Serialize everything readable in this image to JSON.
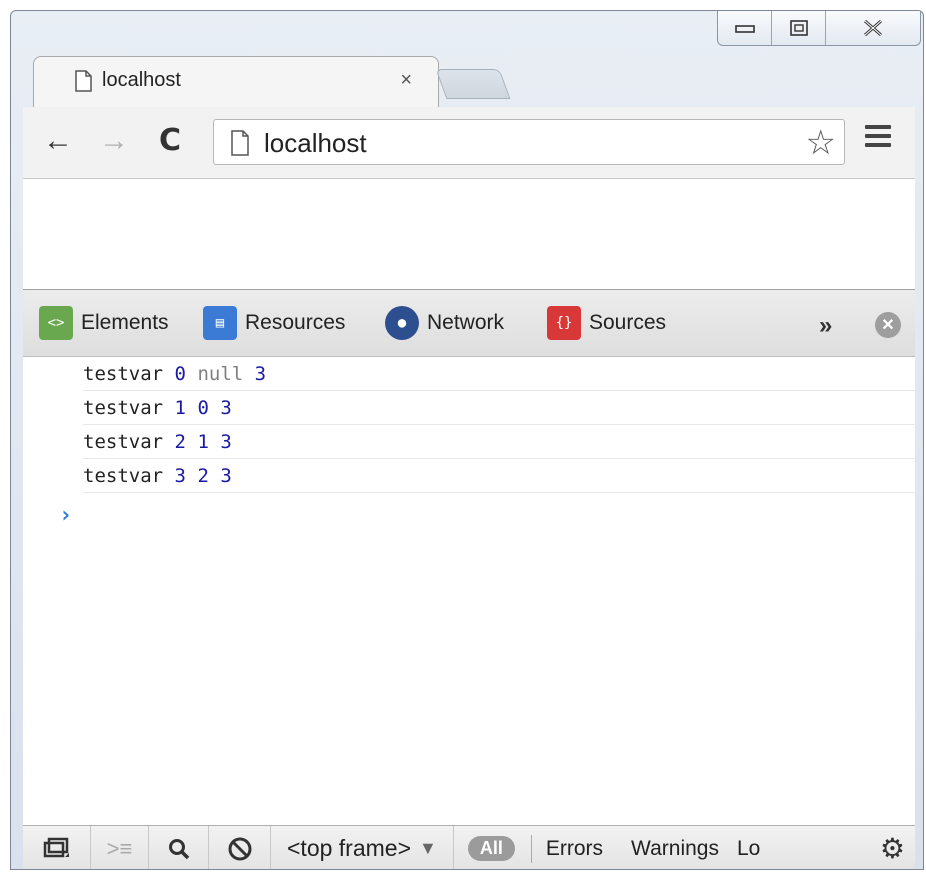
{
  "browser": {
    "tab": {
      "title": "localhost",
      "close": "×"
    },
    "address": "localhost",
    "nav": {
      "back": "←",
      "forward": "→",
      "reload": "C"
    }
  },
  "devtools": {
    "tabs": [
      {
        "label": "Elements",
        "icon": "elements-icon",
        "color": "#6aa84f"
      },
      {
        "label": "Resources",
        "icon": "resources-icon",
        "color": "#3b7bd6"
      },
      {
        "label": "Network",
        "icon": "network-icon",
        "color": "#2d4f8f"
      },
      {
        "label": "Sources",
        "icon": "sources-icon",
        "color": "#d93838"
      }
    ],
    "more": "»",
    "close": "✕"
  },
  "console": {
    "rows": [
      {
        "name": "testvar",
        "a": "0",
        "b": "null",
        "c": "3"
      },
      {
        "name": "testvar",
        "a": "1",
        "b": "0",
        "c": "3"
      },
      {
        "name": "testvar",
        "a": "2",
        "b": "1",
        "c": "3"
      },
      {
        "name": "testvar",
        "a": "3",
        "b": "2",
        "c": "3"
      }
    ],
    "prompt": "›"
  },
  "statusbar": {
    "frame": "<top frame>",
    "frame_arrow": "▼",
    "all": "All",
    "errors": "Errors",
    "warnings": "Warnings",
    "logs": "Lo"
  }
}
